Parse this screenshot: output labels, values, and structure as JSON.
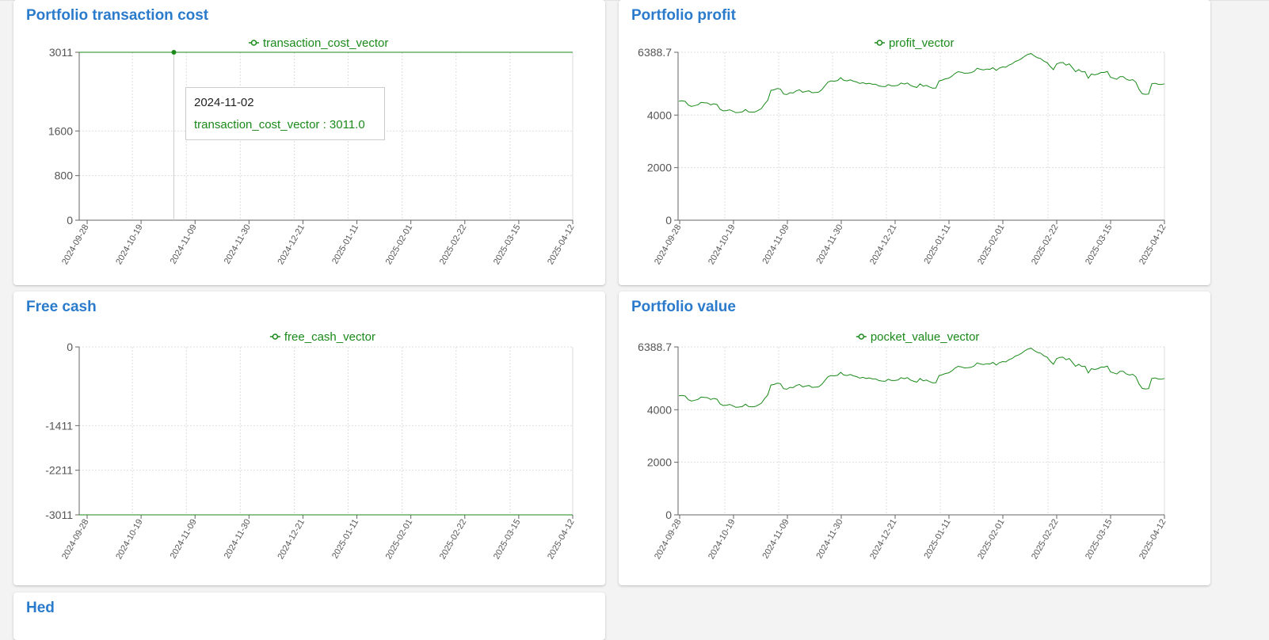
{
  "colors": {
    "title": "#2b7bcc",
    "series": "#1a8a1a",
    "grid": "#dddddd",
    "axis": "#666666",
    "tick_text": "#555555",
    "background": "#f3f3f3"
  },
  "cards": [
    {
      "id": "transaction-cost",
      "title": "Portfolio transaction cost",
      "chart_data": {
        "type": "line",
        "series": [
          {
            "name": "transaction_cost_vector",
            "x": [
              "2024-09-28",
              "2025-04-12"
            ],
            "values": [
              3011.0,
              3011.0
            ]
          }
        ],
        "y_ticks": [
          "0",
          "800",
          "1600",
          "3011"
        ],
        "y_tick_values": [
          0,
          800,
          1600,
          3011
        ],
        "ylim": [
          0,
          3011
        ],
        "x_ticks": [
          "2024-09-28",
          "2024-10-19",
          "2024-11-09",
          "2024-11-30",
          "2024-12-21",
          "2025-01-11",
          "2025-02-01",
          "2025-02-22",
          "2025-03-15",
          "2025-04-12"
        ],
        "legend": "top-center",
        "grid": true
      },
      "tooltip": {
        "date": "2024-11-02",
        "label": "transaction_cost_vector : 3011.0"
      }
    },
    {
      "id": "profit",
      "title": "Portfolio profit",
      "chart_data": {
        "type": "line",
        "series": [
          {
            "name": "profit_vector",
            "values": [
              4530,
              4540,
              4520,
              4380,
              4330,
              4360,
              4390,
              4480,
              4470,
              4460,
              4390,
              4430,
              4400,
              4220,
              4160,
              4170,
              4200,
              4150,
              4090,
              4100,
              4120,
              4210,
              4120,
              4110,
              4120,
              4180,
              4250,
              4420,
              4560,
              4940,
              4960,
              5010,
              4990,
              4800,
              4780,
              4850,
              4840,
              4920,
              4960,
              4870,
              4900,
              4920,
              4850,
              4860,
              4870,
              4960,
              5110,
              5260,
              5300,
              5290,
              5310,
              5420,
              5320,
              5300,
              5340,
              5290,
              5260,
              5200,
              5230,
              5190,
              5210,
              5170,
              5170,
              5110,
              5090,
              5080,
              5160,
              5110,
              5110,
              5130,
              5220,
              5180,
              5220,
              5130,
              5080,
              5050,
              5190,
              5100,
              5130,
              5070,
              5020,
              5030,
              5300,
              5330,
              5380,
              5400,
              5480,
              5580,
              5650,
              5630,
              5590,
              5600,
              5610,
              5660,
              5780,
              5740,
              5720,
              5750,
              5740,
              5800,
              5700,
              5790,
              5830,
              5820,
              5900,
              5950,
              6040,
              6080,
              6150,
              6240,
              6310,
              6340,
              6250,
              6180,
              6150,
              6050,
              6000,
              5850,
              5730,
              5940,
              5990,
              6000,
              5900,
              5950,
              5800,
              5650,
              5730,
              5640,
              5650,
              5400,
              5560,
              5530,
              5560,
              5620,
              5620,
              5660,
              5440,
              5400,
              5360,
              5460,
              5460,
              5360,
              5320,
              5350,
              5250,
              4980,
              4810,
              4790,
              4800,
              5190,
              5210,
              5170,
              5160,
              5190
            ]
          }
        ],
        "x_range": [
          "2024-09-26",
          "2025-04-12"
        ],
        "y_ticks": [
          "0",
          "2000",
          "4000",
          "6388.7"
        ],
        "y_tick_values": [
          0,
          2000,
          4000,
          6388.7
        ],
        "ylim": [
          0,
          6388.7
        ],
        "x_ticks": [
          "2024-09-28",
          "2024-10-19",
          "2024-11-09",
          "2024-11-30",
          "2024-12-21",
          "2025-01-11",
          "2025-02-01",
          "2025-02-22",
          "2025-03-15",
          "2025-04-12"
        ],
        "legend": "top-center",
        "grid": true
      }
    },
    {
      "id": "free-cash",
      "title": "Free cash",
      "chart_data": {
        "type": "line",
        "series": [
          {
            "name": "free_cash_vector",
            "x": [
              "2024-09-28",
              "2025-04-12"
            ],
            "values": [
              -3011,
              -3011
            ]
          }
        ],
        "y_ticks": [
          "-3011",
          "-2211",
          "-1411",
          "0"
        ],
        "y_tick_values": [
          -3011,
          -2211,
          -1411,
          0
        ],
        "ylim": [
          -3011,
          0
        ],
        "x_ticks": [
          "2024-09-28",
          "2024-10-19",
          "2024-11-09",
          "2024-11-30",
          "2024-12-21",
          "2025-01-11",
          "2025-02-01",
          "2025-02-22",
          "2025-03-15",
          "2025-04-12"
        ],
        "legend": "top-center",
        "grid": true
      }
    },
    {
      "id": "portfolio-value",
      "title": "Portfolio value",
      "chart_data": {
        "type": "line",
        "series": [
          {
            "name": "pocket_value_vector",
            "values": [
              4530,
              4540,
              4520,
              4380,
              4330,
              4360,
              4390,
              4480,
              4470,
              4460,
              4390,
              4430,
              4400,
              4220,
              4160,
              4170,
              4200,
              4150,
              4090,
              4100,
              4120,
              4210,
              4120,
              4110,
              4120,
              4180,
              4250,
              4420,
              4560,
              4940,
              4960,
              5010,
              4990,
              4800,
              4780,
              4850,
              4840,
              4920,
              4960,
              4870,
              4900,
              4920,
              4850,
              4860,
              4870,
              4960,
              5110,
              5260,
              5300,
              5290,
              5310,
              5420,
              5320,
              5300,
              5340,
              5290,
              5260,
              5200,
              5230,
              5190,
              5210,
              5170,
              5170,
              5110,
              5090,
              5080,
              5160,
              5110,
              5110,
              5130,
              5220,
              5180,
              5220,
              5130,
              5080,
              5050,
              5190,
              5100,
              5130,
              5070,
              5020,
              5030,
              5300,
              5330,
              5380,
              5400,
              5480,
              5580,
              5650,
              5630,
              5590,
              5600,
              5610,
              5660,
              5780,
              5740,
              5720,
              5750,
              5740,
              5800,
              5700,
              5790,
              5830,
              5820,
              5900,
              5950,
              6040,
              6080,
              6150,
              6240,
              6310,
              6340,
              6250,
              6180,
              6150,
              6050,
              6000,
              5850,
              5730,
              5940,
              5990,
              6000,
              5900,
              5950,
              5800,
              5650,
              5730,
              5640,
              5650,
              5400,
              5560,
              5530,
              5560,
              5620,
              5620,
              5660,
              5440,
              5400,
              5360,
              5460,
              5460,
              5360,
              5320,
              5350,
              5250,
              4980,
              4810,
              4790,
              4800,
              5190,
              5210,
              5170,
              5160,
              5190
            ]
          }
        ],
        "x_range": [
          "2024-09-26",
          "2025-04-12"
        ],
        "y_ticks": [
          "0",
          "2000",
          "4000",
          "6388.7"
        ],
        "y_tick_values": [
          0,
          2000,
          4000,
          6388.7
        ],
        "ylim": [
          0,
          6388.7
        ],
        "x_ticks": [
          "2024-09-28",
          "2024-10-19",
          "2024-11-09",
          "2024-11-30",
          "2024-12-21",
          "2025-01-11",
          "2025-02-01",
          "2025-02-22",
          "2025-03-15",
          "2025-04-12"
        ],
        "legend": "top-center",
        "grid": true
      }
    }
  ],
  "bottom_card": {
    "title": "Hed"
  }
}
